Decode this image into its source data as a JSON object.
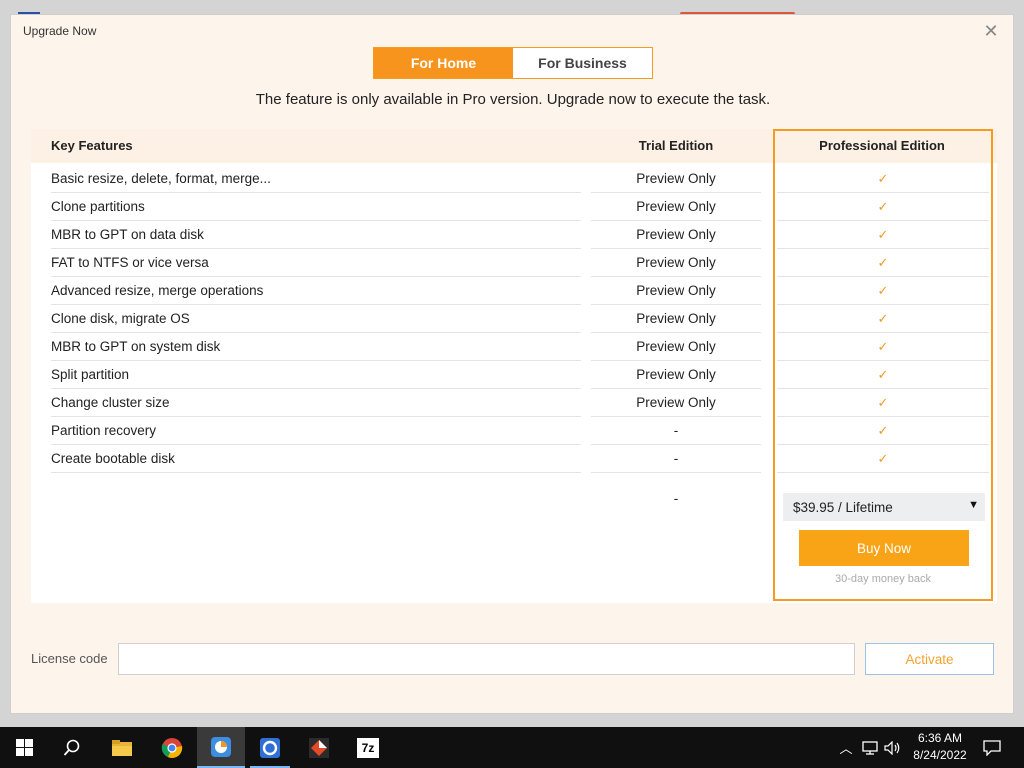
{
  "dialog": {
    "title": "Upgrade Now",
    "tabs": [
      {
        "label": "For Home",
        "active": true
      },
      {
        "label": "For Business",
        "active": false
      }
    ],
    "subtitle": "The feature is only available in Pro version. Upgrade now to execute the task."
  },
  "table": {
    "headers": {
      "features": "Key Features",
      "trial": "Trial Edition",
      "pro": "Professional Edition"
    },
    "rows": [
      {
        "feature": "Basic resize, delete, format, merge...",
        "trial": "Preview Only",
        "pro": "✓"
      },
      {
        "feature": "Clone partitions",
        "trial": "Preview Only",
        "pro": "✓"
      },
      {
        "feature": "MBR to GPT on data disk",
        "trial": "Preview Only",
        "pro": "✓"
      },
      {
        "feature": "FAT to NTFS or vice versa",
        "trial": "Preview Only",
        "pro": "✓"
      },
      {
        "feature": "Advanced resize, merge operations",
        "trial": "Preview Only",
        "pro": "✓"
      },
      {
        "feature": "Clone disk, migrate OS",
        "trial": "Preview Only",
        "pro": "✓"
      },
      {
        "feature": "MBR to GPT on system disk",
        "trial": "Preview Only",
        "pro": "✓"
      },
      {
        "feature": "Split partition",
        "trial": "Preview Only",
        "pro": "✓"
      },
      {
        "feature": "Change cluster size",
        "trial": "Preview Only",
        "pro": "✓"
      },
      {
        "feature": "Partition recovery",
        "trial": "-",
        "pro": "✓"
      },
      {
        "feature": "Create bootable disk",
        "trial": "-",
        "pro": "✓"
      }
    ],
    "trial_price": "-",
    "price_option": "$39.95 / Lifetime",
    "buy_label": "Buy Now",
    "money_back": "30-day money back"
  },
  "license": {
    "label": "License code",
    "value": "",
    "activate_label": "Activate"
  },
  "taskbar": {
    "time": "6:36 AM",
    "date": "8/24/2022",
    "apps": [
      "start",
      "search",
      "file-explorer",
      "chrome",
      "partition-assistant",
      "app-blue",
      "app-dark",
      "7zip"
    ],
    "sevenzip_label": "7z"
  },
  "colors": {
    "accent": "#f7941d",
    "check": "#f29a26",
    "frame": "#f39c1f"
  }
}
